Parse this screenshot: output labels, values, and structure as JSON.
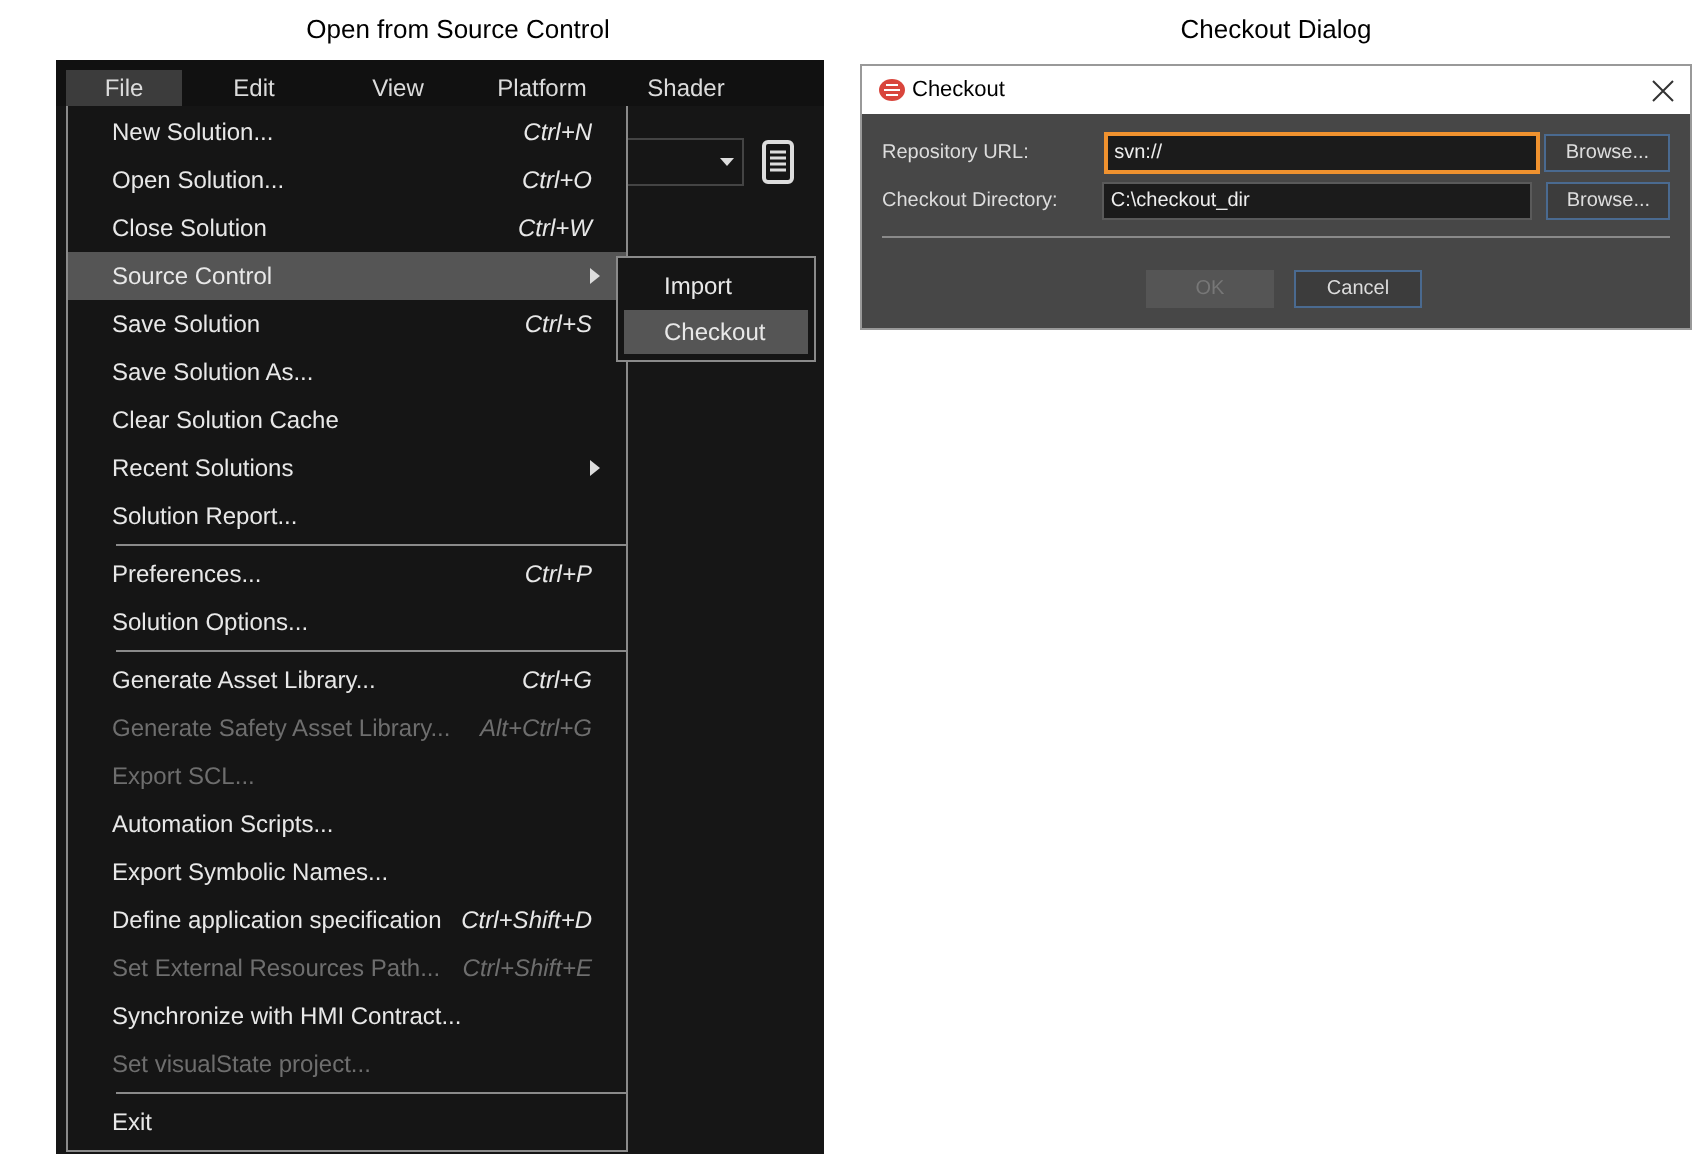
{
  "captions": [
    "Open from Source Control",
    "Checkout Dialog"
  ],
  "menubar": [
    {
      "label": "File",
      "selected": true
    },
    {
      "label": "Edit",
      "selected": false
    },
    {
      "label": "View",
      "selected": false
    },
    {
      "label": "Platform",
      "selected": false
    },
    {
      "label": "Shader",
      "selected": false
    }
  ],
  "file_menu": [
    {
      "kind": "item",
      "label": "New Solution...",
      "shortcut": "Ctrl+N",
      "disabled": false,
      "has_submenu": false,
      "selected": false
    },
    {
      "kind": "item",
      "label": "Open Solution...",
      "shortcut": "Ctrl+O",
      "disabled": false,
      "has_submenu": false,
      "selected": false
    },
    {
      "kind": "item",
      "label": "Close Solution",
      "shortcut": "Ctrl+W",
      "disabled": false,
      "has_submenu": false,
      "selected": false
    },
    {
      "kind": "item",
      "label": "Source Control",
      "disabled": false,
      "has_submenu": true,
      "selected": true
    },
    {
      "kind": "item",
      "label": "Save Solution",
      "shortcut": "Ctrl+S",
      "disabled": false,
      "has_submenu": false,
      "selected": false
    },
    {
      "kind": "item",
      "label": "Save Solution As...",
      "disabled": false,
      "has_submenu": false,
      "selected": false
    },
    {
      "kind": "item",
      "label": "Clear Solution Cache",
      "disabled": false,
      "has_submenu": false,
      "selected": false
    },
    {
      "kind": "item",
      "label": "Recent Solutions",
      "disabled": false,
      "has_submenu": true,
      "selected": false
    },
    {
      "kind": "item",
      "label": "Solution Report...",
      "disabled": false,
      "has_submenu": false,
      "selected": false
    },
    {
      "kind": "separator"
    },
    {
      "kind": "item",
      "label": "Preferences...",
      "shortcut": "Ctrl+P",
      "disabled": false,
      "has_submenu": false,
      "selected": false
    },
    {
      "kind": "item",
      "label": "Solution Options...",
      "disabled": false,
      "has_submenu": false,
      "selected": false
    },
    {
      "kind": "separator"
    },
    {
      "kind": "item",
      "label": "Generate Asset Library...",
      "shortcut": "Ctrl+G",
      "disabled": false,
      "has_submenu": false,
      "selected": false
    },
    {
      "kind": "item",
      "label": "Generate Safety Asset Library...",
      "shortcut": "Alt+Ctrl+G",
      "disabled": true,
      "has_submenu": false,
      "selected": false
    },
    {
      "kind": "item",
      "label": "Export SCL...",
      "disabled": true,
      "has_submenu": false,
      "selected": false
    },
    {
      "kind": "item",
      "label": "Automation Scripts...",
      "disabled": false,
      "has_submenu": false,
      "selected": false
    },
    {
      "kind": "item",
      "label": "Export Symbolic Names...",
      "disabled": false,
      "has_submenu": false,
      "selected": false
    },
    {
      "kind": "item",
      "label": "Define application specification",
      "shortcut": "Ctrl+Shift+D",
      "disabled": false,
      "has_submenu": false,
      "selected": false
    },
    {
      "kind": "item",
      "label": "Set External Resources Path...",
      "shortcut": "Ctrl+Shift+E",
      "disabled": true,
      "has_submenu": false,
      "selected": false
    },
    {
      "kind": "item",
      "label": "Synchronize with HMI Contract...",
      "disabled": false,
      "has_submenu": false,
      "selected": false
    },
    {
      "kind": "item",
      "label": "Set visualState project...",
      "disabled": true,
      "has_submenu": false,
      "selected": false
    },
    {
      "kind": "separator"
    },
    {
      "kind": "item",
      "label": "Exit",
      "disabled": false,
      "has_submenu": false,
      "selected": false
    }
  ],
  "source_control_submenu": [
    {
      "label": "Import",
      "selected": false
    },
    {
      "label": "Checkout",
      "selected": true
    }
  ],
  "dialog": {
    "title": "Checkout",
    "fields": [
      {
        "label": "Repository URL:",
        "value": "svn://",
        "focused": true,
        "button": "Browse..."
      },
      {
        "label": "Checkout Directory:",
        "value": "C:\\checkout_dir",
        "focused": false,
        "button": "Browse..."
      }
    ],
    "buttons": [
      {
        "label": "OK",
        "disabled": true
      },
      {
        "label": "Cancel",
        "disabled": false
      }
    ]
  }
}
